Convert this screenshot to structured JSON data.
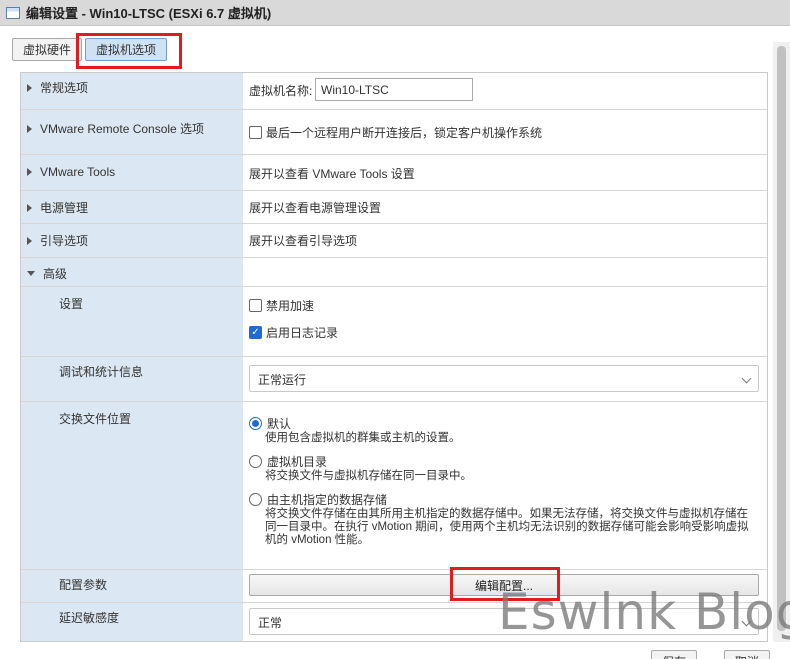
{
  "window": {
    "title": "编辑设置 - Win10-LTSC (ESXi 6.7 虚拟机)"
  },
  "tabs": [
    {
      "label": "虚拟硬件",
      "active": false
    },
    {
      "label": "虚拟机选项",
      "active": true
    }
  ],
  "sections": {
    "general": {
      "label": "常规选项",
      "vm_name_label": "虚拟机名称:",
      "vm_name_value": "Win10-LTSC"
    },
    "vmrc": {
      "label": "VMware Remote Console 选项",
      "lock_checkbox": "最后一个远程用户断开连接后，锁定客户机操作系统",
      "lock_checked": false
    },
    "tools": {
      "label": "VMware Tools",
      "value": "展开以查看 VMware Tools 设置"
    },
    "power": {
      "label": "电源管理",
      "value": "展开以查看电源管理设置"
    },
    "boot": {
      "label": "引导选项",
      "value": "展开以查看引导选项"
    },
    "advanced": {
      "label": "高级",
      "settings_label": "设置",
      "disable_accel": "禁用加速",
      "disable_accel_checked": false,
      "enable_logging": "启用日志记录",
      "enable_logging_checked": true,
      "debug_label": "调试和统计信息",
      "debug_value": "正常运行",
      "swap_label": "交换文件位置",
      "swap_options": [
        {
          "title": "默认",
          "desc": "使用包含虚拟机的群集或主机的设置。",
          "selected": true
        },
        {
          "title": "虚拟机目录",
          "desc": "将交换文件与虚拟机存储在同一目录中。",
          "selected": false
        },
        {
          "title": "由主机指定的数据存储",
          "desc": "将交换文件存储在由其所用主机指定的数据存储中。如果无法存储，将交换文件与虚拟机存储在同一目录中。在执行 vMotion 期间，使用两个主机均无法识别的数据存储可能会影响受影响虚拟机的 vMotion 性能。",
          "selected": false
        }
      ],
      "config_params_label": "配置参数",
      "edit_config_button": "编辑配置...",
      "latency_label": "延迟敏感度",
      "latency_value": "正常"
    }
  },
  "footer": {
    "save": "保存",
    "cancel": "取消"
  },
  "watermark": "Eswlnk Blog",
  "colors": {
    "accent": "#1e6bd6",
    "highlight": "#e01c1c",
    "label_column": "#dbe8f4"
  }
}
